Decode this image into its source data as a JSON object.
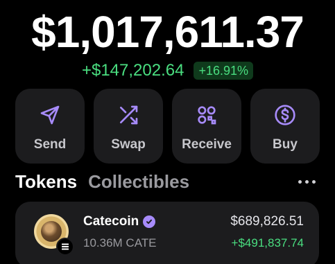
{
  "balance": {
    "total": "$1,017,611.37",
    "change_amount": "+$147,202.64",
    "change_percent": "+16.91%"
  },
  "actions": [
    {
      "label": "Send",
      "icon": "send-icon"
    },
    {
      "label": "Swap",
      "icon": "swap-icon"
    },
    {
      "label": "Receive",
      "icon": "qr-code-icon"
    },
    {
      "label": "Buy",
      "icon": "dollar-icon"
    }
  ],
  "tabs": [
    {
      "label": "Tokens",
      "active": true
    },
    {
      "label": "Collectibles",
      "active": false
    }
  ],
  "token": {
    "name": "Catecoin",
    "balance": "10.36M CATE",
    "value": "$689,826.51",
    "gain": "+$491,837.74",
    "verified_icon": "verified-check-icon",
    "chain_icon": "solana-icon"
  },
  "colors": {
    "accent": "#a78bfa",
    "positive": "#4ade80",
    "card": "#1c1c1e",
    "background": "#000000"
  }
}
